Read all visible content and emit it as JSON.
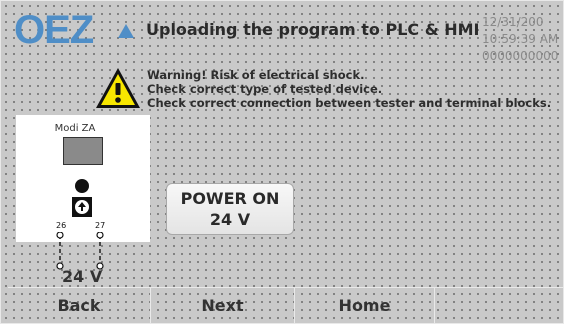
{
  "header": {
    "logo_text": "OEZ",
    "title": "Uploading the program to PLC & HMI",
    "date": "12/31/200",
    "time": "10:59:39 AM",
    "counter": "0000000000"
  },
  "warnings": [
    "Warning! Risk of electrical shock.",
    "Check correct type of tested device.",
    "Check correct connection between tester and terminal blocks."
  ],
  "device": {
    "name": "Modi ZA",
    "terminal_left": "26",
    "terminal_right": "27",
    "voltage": "24 V"
  },
  "power_button": {
    "line1": "POWER ON",
    "line2": "24 V"
  },
  "nav": {
    "back": "Back",
    "next": "Next",
    "home": "Home"
  },
  "colors": {
    "background": "#c9c9c9",
    "logo": "#4f8ec7",
    "warning_yellow": "#f7e600"
  }
}
